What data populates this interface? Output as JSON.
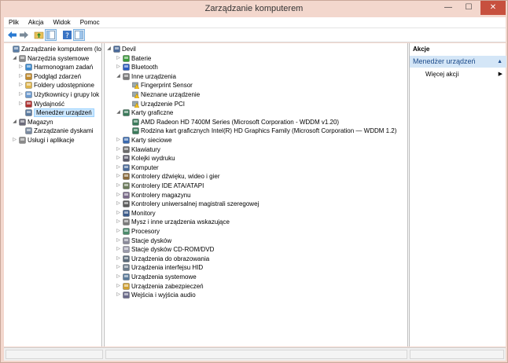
{
  "window": {
    "title": "Zarządzanie komputerem",
    "minimize": "—",
    "maximize": "☐",
    "close": "✕"
  },
  "menu": [
    "Plik",
    "Akcja",
    "Widok",
    "Pomoc"
  ],
  "toolbar": {
    "icons": [
      "back-arrow-icon",
      "forward-arrow-icon",
      "folder-up-icon",
      "show-tree-icon",
      "help-icon",
      "properties-icon"
    ]
  },
  "left_tree": [
    {
      "label": "Zarządzanie komputerem (loka",
      "level": 0,
      "expander": "",
      "icon": "computer-management-icon"
    },
    {
      "label": "Narzędzia systemowe",
      "level": 1,
      "expander": "◢",
      "icon": "tools-icon"
    },
    {
      "label": "Harmonogram zadań",
      "level": 2,
      "expander": "▷",
      "icon": "clock-icon"
    },
    {
      "label": "Podgląd zdarzeń",
      "level": 2,
      "expander": "▷",
      "icon": "event-viewer-icon"
    },
    {
      "label": "Foldery udostępnione",
      "level": 2,
      "expander": "▷",
      "icon": "shared-folder-icon"
    },
    {
      "label": "Użytkownicy i grupy lok",
      "level": 2,
      "expander": "▷",
      "icon": "users-icon"
    },
    {
      "label": "Wydajność",
      "level": 2,
      "expander": "▷",
      "icon": "performance-icon"
    },
    {
      "label": "Menedżer urządzeń",
      "level": 2,
      "expander": "",
      "icon": "device-manager-icon",
      "selected": true
    },
    {
      "label": "Magazyn",
      "level": 1,
      "expander": "◢",
      "icon": "storage-icon"
    },
    {
      "label": "Zarządzanie dyskami",
      "level": 2,
      "expander": "",
      "icon": "disk-icon"
    },
    {
      "label": "Usługi i aplikacje",
      "level": 1,
      "expander": "▷",
      "icon": "services-icon"
    }
  ],
  "device_tree": [
    {
      "label": "Devil",
      "level": 0,
      "expander": "◢",
      "icon": "computer-icon"
    },
    {
      "label": "Baterie",
      "level": 1,
      "expander": "▷",
      "icon": "battery-icon"
    },
    {
      "label": "Bluetooth",
      "level": 1,
      "expander": "▷",
      "icon": "bluetooth-icon"
    },
    {
      "label": "Inne urządzenia",
      "level": 1,
      "expander": "◢",
      "icon": "other-devices-icon"
    },
    {
      "label": "Fingerprint Sensor",
      "level": 2,
      "expander": "",
      "icon": "warning-device-icon"
    },
    {
      "label": "Nieznane urządzenie",
      "level": 2,
      "expander": "",
      "icon": "warning-device-icon"
    },
    {
      "label": "Urządzenie PCI",
      "level": 2,
      "expander": "",
      "icon": "warning-device-icon"
    },
    {
      "label": "Karty graficzne",
      "level": 1,
      "expander": "◢",
      "icon": "display-adapter-icon"
    },
    {
      "label": "AMD Radeon HD 7400M Series (Microsoft Corporation - WDDM v1.20)",
      "level": 2,
      "expander": "",
      "icon": "display-adapter-icon"
    },
    {
      "label": "Rodzina kart graficznych Intel(R) HD Graphics Family (Microsoft Corporation — WDDM 1.2)",
      "level": 2,
      "expander": "",
      "icon": "display-adapter-icon"
    },
    {
      "label": "Karty sieciowe",
      "level": 1,
      "expander": "▷",
      "icon": "network-icon"
    },
    {
      "label": "Klawiatury",
      "level": 1,
      "expander": "▷",
      "icon": "keyboard-icon"
    },
    {
      "label": "Kolejki wydruku",
      "level": 1,
      "expander": "▷",
      "icon": "printer-icon"
    },
    {
      "label": "Komputer",
      "level": 1,
      "expander": "▷",
      "icon": "computer-icon"
    },
    {
      "label": "Kontrolery dźwięku, wideo i gier",
      "level": 1,
      "expander": "▷",
      "icon": "sound-icon"
    },
    {
      "label": "Kontrolery IDE ATA/ATAPI",
      "level": 1,
      "expander": "▷",
      "icon": "ide-icon"
    },
    {
      "label": "Kontrolery magazynu",
      "level": 1,
      "expander": "▷",
      "icon": "storage-controller-icon"
    },
    {
      "label": "Kontrolery uniwersalnej magistrali szeregowej",
      "level": 1,
      "expander": "▷",
      "icon": "usb-icon"
    },
    {
      "label": "Monitory",
      "level": 1,
      "expander": "▷",
      "icon": "monitor-icon"
    },
    {
      "label": "Mysz i inne urządzenia wskazujące",
      "level": 1,
      "expander": "▷",
      "icon": "mouse-icon"
    },
    {
      "label": "Procesory",
      "level": 1,
      "expander": "▷",
      "icon": "processor-icon"
    },
    {
      "label": "Stacje dysków",
      "level": 1,
      "expander": "▷",
      "icon": "disk-drive-icon"
    },
    {
      "label": "Stacje dysków CD-ROM/DVD",
      "level": 1,
      "expander": "▷",
      "icon": "cdrom-icon"
    },
    {
      "label": "Urządzenia do obrazowania",
      "level": 1,
      "expander": "▷",
      "icon": "camera-icon"
    },
    {
      "label": "Urządzenia interfejsu HID",
      "level": 1,
      "expander": "▷",
      "icon": "hid-icon"
    },
    {
      "label": "Urządzenia systemowe",
      "level": 1,
      "expander": "▷",
      "icon": "system-devices-icon"
    },
    {
      "label": "Urządzenia zabezpieczeń",
      "level": 1,
      "expander": "▷",
      "icon": "security-device-icon"
    },
    {
      "label": "Wejścia i wyjścia audio",
      "level": 1,
      "expander": "▷",
      "icon": "audio-io-icon"
    }
  ],
  "actions": {
    "header": "Akcje",
    "section": "Menedżer urządzeń",
    "section_caret": "▲",
    "more": "Więcej akcji",
    "more_caret": "▶"
  }
}
